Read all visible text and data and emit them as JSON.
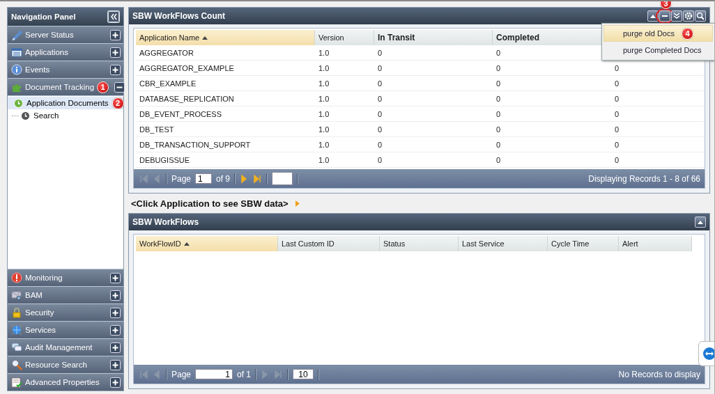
{
  "navigation_panel": {
    "title": "Navigation Panel",
    "sections_top": [
      {
        "label": "Server Status",
        "expanded": false
      },
      {
        "label": "Applications",
        "expanded": false
      },
      {
        "label": "Events",
        "expanded": false
      },
      {
        "label": "Document Tracking",
        "expanded": true,
        "callout": "1"
      }
    ],
    "tree": [
      {
        "label": "Application Documents",
        "selected": true,
        "callout": "2"
      },
      {
        "label": "Search",
        "selected": false
      }
    ],
    "sections_bottom": [
      {
        "label": "Monitoring",
        "expanded": false
      },
      {
        "label": "BAM",
        "expanded": false
      },
      {
        "label": "Security",
        "expanded": false
      },
      {
        "label": "Services",
        "expanded": false
      },
      {
        "label": "Audit Management",
        "expanded": false
      },
      {
        "label": "Resource Search",
        "expanded": false
      },
      {
        "label": "Advanced Properties",
        "expanded": false
      }
    ]
  },
  "counts_panel": {
    "title": "SBW WorkFlows Count",
    "tool_callout": "3",
    "columns": [
      {
        "label": "Application Name",
        "sorted": true
      },
      {
        "label": "Version",
        "sorted": false
      },
      {
        "label": "In Transit",
        "sorted": false
      },
      {
        "label": "Completed",
        "sorted": false
      }
    ],
    "rows": [
      [
        "AGGREGATOR",
        "1.0",
        "0",
        "0"
      ],
      [
        "AGGREGATOR_EXAMPLE",
        "1.0",
        "0",
        "0",
        "0"
      ],
      [
        "CBR_EXAMPLE",
        "1.0",
        "0",
        "0",
        "0"
      ],
      [
        "DATABASE_REPLICATION",
        "1.0",
        "0",
        "0",
        "0"
      ],
      [
        "DB_EVENT_PROCESS",
        "1.0",
        "0",
        "0",
        "0"
      ],
      [
        "DB_TEST",
        "1.0",
        "0",
        "0",
        "0"
      ],
      [
        "DB_TRANSACTION_SUPPORT",
        "1.0",
        "0",
        "0",
        "0"
      ],
      [
        "DEBUGISSUE",
        "1.0",
        "0",
        "0",
        "0"
      ]
    ],
    "pager": {
      "nav": [
        {
          "disabled": true
        },
        {
          "disabled": true
        },
        {
          "disabled": false
        },
        {
          "disabled": false
        }
      ],
      "page_label": "Page",
      "page": "1",
      "of": "of 9",
      "status": "Displaying Records 1 - 8 of 66"
    },
    "menu": [
      {
        "label": "purge old Docs",
        "selected": true,
        "callout": "4"
      },
      {
        "label": "purge Completed Docs",
        "selected": false
      }
    ]
  },
  "hint": "<Click Application to see SBW data>",
  "workflows_panel": {
    "title": "SBW WorkFlows",
    "columns": [
      {
        "label": "WorkFlowID",
        "sorted": true
      },
      {
        "label": "Last Custom ID",
        "sorted": false
      },
      {
        "label": "Status",
        "sorted": false
      },
      {
        "label": "Last Service",
        "sorted": false
      },
      {
        "label": "Cycle Time",
        "sorted": false
      },
      {
        "label": "Alert",
        "sorted": false
      }
    ],
    "pager": {
      "nav": [
        {
          "disabled": true
        },
        {
          "disabled": true
        },
        {
          "disabled": true
        },
        {
          "disabled": true
        }
      ],
      "page_label": "Page",
      "page": "1",
      "of": "of 1",
      "page_size": "10",
      "status": "No Records to display"
    }
  }
}
